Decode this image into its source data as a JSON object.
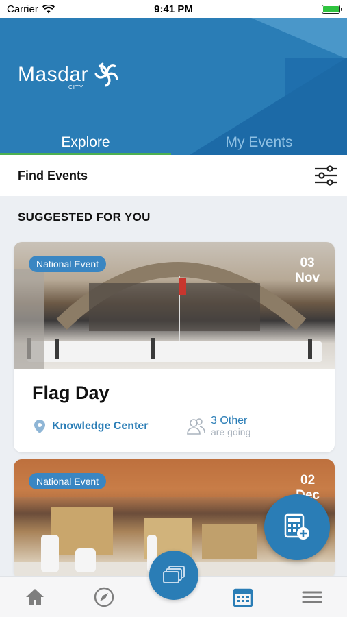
{
  "status_bar": {
    "carrier": "Carrier",
    "time": "9:41 PM"
  },
  "header": {
    "logo_text": "Masdar",
    "logo_sub": "CITY"
  },
  "tabs": [
    {
      "label": "Explore",
      "active": true
    },
    {
      "label": "My Events",
      "active": false
    }
  ],
  "find_bar": {
    "label": "Find Events"
  },
  "section": {
    "title": "SUGGESTED FOR YOU"
  },
  "events": [
    {
      "badge": "National Event",
      "day": "03",
      "month": "Nov",
      "title": "Flag Day",
      "location": "Knowledge Center",
      "going_count": "3 Other",
      "going_sub": "are going"
    },
    {
      "badge": "National Event",
      "day": "02",
      "month": "Dec"
    }
  ],
  "nav": {
    "items": [
      "home-icon",
      "compass-icon",
      "gallery-icon",
      "calendar-icon",
      "menu-icon"
    ],
    "active": "calendar-icon"
  },
  "colors": {
    "primary": "#2a7db6",
    "accent": "#4caf50"
  }
}
